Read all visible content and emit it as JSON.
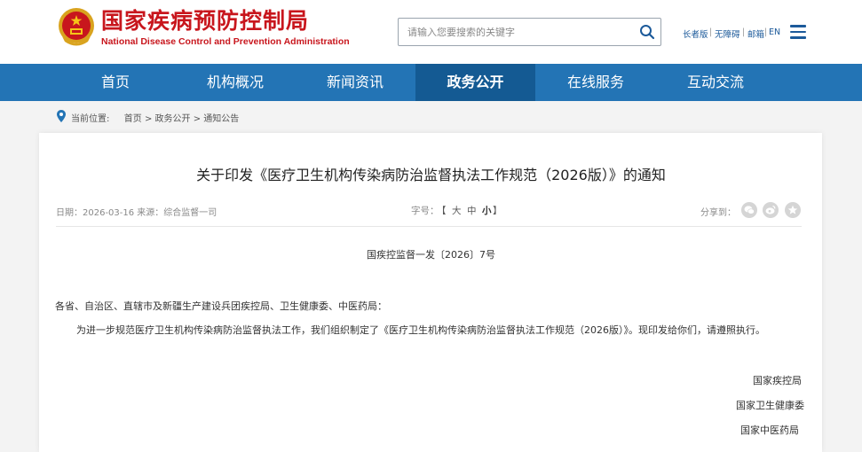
{
  "header": {
    "site_name_cn": "国家疾病预防控制局",
    "site_name_en": "National Disease Control and Prevention Administration",
    "search_placeholder": "请输入您要搜索的关键字",
    "util_links": [
      "长者版",
      "无障碍",
      "邮箱",
      "EN"
    ]
  },
  "nav": {
    "items": [
      "首页",
      "机构概况",
      "新闻资讯",
      "政务公开",
      "在线服务",
      "互动交流"
    ],
    "active_index": 3
  },
  "breadcrumb": {
    "label": "当前位置:",
    "path": [
      "首页",
      "政务公开",
      "通知公告"
    ],
    "separator": ">"
  },
  "article": {
    "title": "关于印发《医疗卫生机构传染病防治监督执法工作规范（2026版）》的通知",
    "meta_date": "日期：2026-03-16 来源：综合监督一司",
    "font_size_label": "字号：",
    "font_size_bracket_open": "【",
    "font_size_options": [
      "大",
      "中",
      "小"
    ],
    "font_size_bracket_close": "】",
    "font_size_selected": 2,
    "share_label": "分享到：",
    "share_icons": [
      "wechat-icon",
      "weibo-icon",
      "star-icon"
    ],
    "doc_number": "国疾控监督一发〔2026〕7号",
    "salutation": "各省、自治区、直辖市及新疆生产建设兵团疾控局、卫生健康委、中医药局：",
    "body": "为进一步规范医疗卫生机构传染病防治监督执法工作，我们组织制定了《医疗卫生机构传染病防治监督执法工作规范（2026版）》。现印发给你们，请遵照执行。",
    "signatories": [
      "国家疾控局",
      "国家卫生健康委",
      "国家中医药局"
    ]
  },
  "colors": {
    "brand_red": "#c8161d",
    "nav_blue": "#2374b5",
    "nav_active": "#145a93",
    "link_blue": "#1c5a9a"
  }
}
